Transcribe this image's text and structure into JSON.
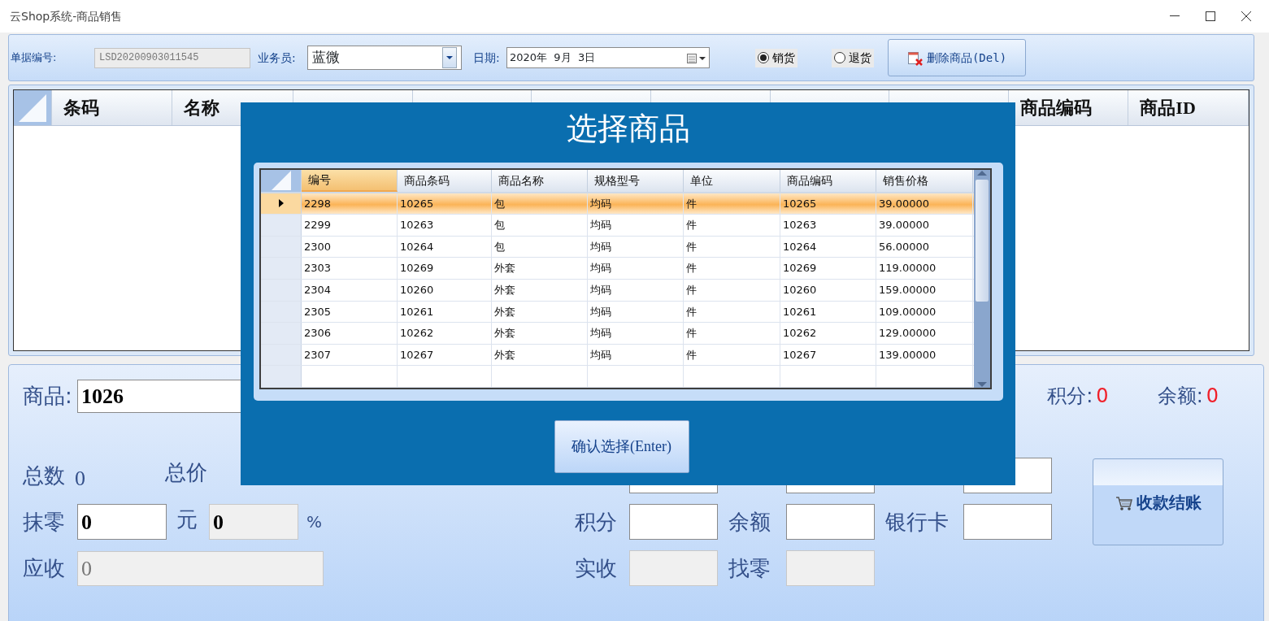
{
  "window": {
    "title": "云Shop系统-商品销售"
  },
  "toolbar": {
    "doc_label": "单据编号:",
    "doc_value": "LSD20200903011545",
    "staff_label": "业务员:",
    "staff_value": "蓝微",
    "date_label": "日期:",
    "date_value": "2020年  9月  3日",
    "modes": [
      {
        "label": "销货",
        "selected": true
      },
      {
        "label": "退货",
        "selected": false
      }
    ],
    "delete_button": "删除商品(Del)"
  },
  "main_grid": {
    "columns_left": [
      "条码",
      "名称"
    ],
    "columns_right": [
      "商品编码",
      "商品ID"
    ]
  },
  "summary": {
    "product_label": "商品:",
    "product_value": "1026",
    "points_label": "积分:",
    "points_value": "0",
    "balance_label": "余额:",
    "balance_value": "0",
    "count_label": "总数",
    "count_value": "0",
    "total_label": "总价",
    "round_label": "抹零",
    "round_value": "0",
    "yuan_label": "元",
    "percent_value": "0",
    "percent_label": "%",
    "due_label": "应收",
    "due_value": "0",
    "pay_points_label": "积分",
    "pay_balance_label": "余额",
    "pay_card_label": "银行卡",
    "received_label": "实收",
    "change_label": "找零",
    "checkout_button": "收款结账"
  },
  "dialog": {
    "title": "选择商品",
    "columns": [
      {
        "label": "编号",
        "selected": true
      },
      {
        "label": "商品条码",
        "selected": false
      },
      {
        "label": "商品名称",
        "selected": false
      },
      {
        "label": "规格型号",
        "selected": false
      },
      {
        "label": "单位",
        "selected": false
      },
      {
        "label": "商品编码",
        "selected": false
      },
      {
        "label": "销售价格",
        "selected": false
      }
    ],
    "rows": [
      {
        "selected": true,
        "cells": [
          "2298",
          "10265",
          "包",
          "均码",
          "件",
          "10265",
          "39.00000"
        ]
      },
      {
        "selected": false,
        "cells": [
          "2299",
          "10263",
          "包",
          "均码",
          "件",
          "10263",
          "39.00000"
        ]
      },
      {
        "selected": false,
        "cells": [
          "2300",
          "10264",
          "包",
          "均码",
          "件",
          "10264",
          "56.00000"
        ]
      },
      {
        "selected": false,
        "cells": [
          "2303",
          "10269",
          "外套",
          "均码",
          "件",
          "10269",
          "119.00000"
        ]
      },
      {
        "selected": false,
        "cells": [
          "2304",
          "10260",
          "外套",
          "均码",
          "件",
          "10260",
          "159.00000"
        ]
      },
      {
        "selected": false,
        "cells": [
          "2305",
          "10261",
          "外套",
          "均码",
          "件",
          "10261",
          "109.00000"
        ]
      },
      {
        "selected": false,
        "cells": [
          "2306",
          "10262",
          "外套",
          "均码",
          "件",
          "10262",
          "129.00000"
        ]
      },
      {
        "selected": false,
        "cells": [
          "2307",
          "10267",
          "外套",
          "均码",
          "件",
          "10267",
          "139.00000"
        ]
      }
    ],
    "confirm_button": "确认选择(Enter)"
  }
}
